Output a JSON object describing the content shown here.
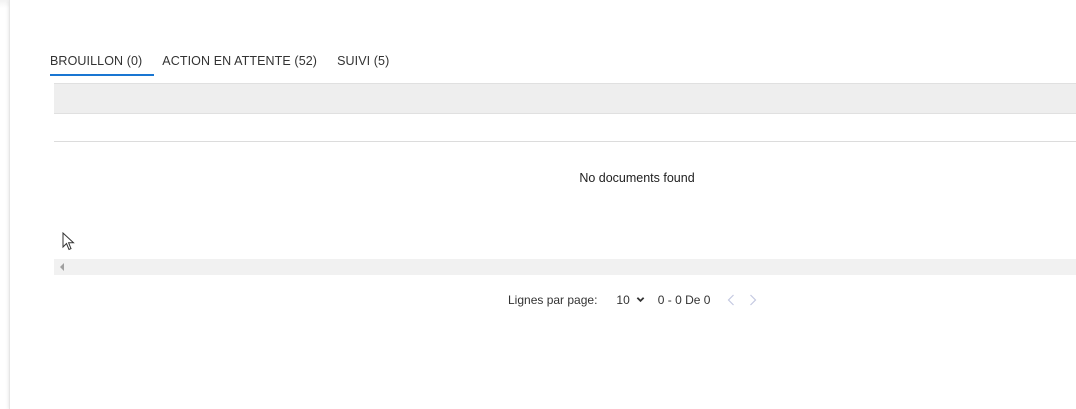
{
  "tabs": [
    {
      "label": "BROUILLON (0)",
      "active": true
    },
    {
      "label": "ACTION EN ATTENTE (52)",
      "active": false
    },
    {
      "label": "SUIVI (5)",
      "active": false
    }
  ],
  "table": {
    "empty_message": "No documents found"
  },
  "pagination": {
    "rows_label": "Lignes par page:",
    "rows_value": "10",
    "range_text": "0 - 0 De 0"
  },
  "icons": {
    "prev": "chevron-left-icon",
    "next": "chevron-right-icon",
    "select": "chevron-down-icon",
    "scroll": "scroll-left-arrow-icon",
    "pointer": "mouse-pointer-icon"
  },
  "colors": {
    "accent": "#1976d2",
    "header_bg": "#eeeeee",
    "nav_disabled": "#c3c8e0"
  }
}
